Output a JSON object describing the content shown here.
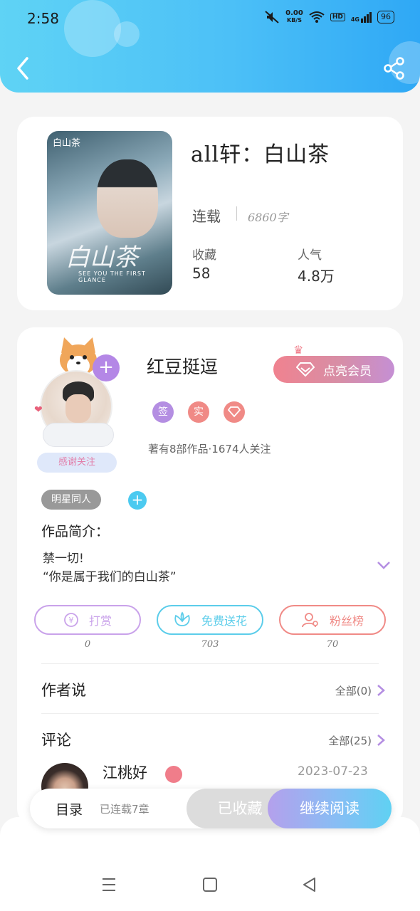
{
  "status_bar": {
    "time": "2:58",
    "net_speed": "0.00",
    "net_unit": "KB/S",
    "hd": "HD",
    "signal": "4G",
    "battery": "96"
  },
  "book": {
    "title": "all轩：白山茶",
    "status": "连载",
    "word_count": "6860字",
    "favorites_label": "收藏",
    "favorites_value": "58",
    "popularity_label": "人气",
    "popularity_value": "4.8万",
    "cover_text": "白山茶",
    "cover_art_title": "白山茶",
    "cover_subtitle": "SEE YOU THE FIRST GLANCE"
  },
  "author": {
    "name": "红豆挺逗",
    "vip_button": "点亮会员",
    "badges": [
      "签",
      "实"
    ],
    "meta": "著有8部作品·1674人关注",
    "thanks_label": "感谢关注",
    "tag": "明星同人",
    "tag_add": "+"
  },
  "intro": {
    "label": "作品简介：",
    "line1": "禁一切!",
    "line2": "“你是属于我们的白山茶”"
  },
  "actions": [
    {
      "label": "打赏",
      "count": "0",
      "color": "#c9a2ea"
    },
    {
      "label": "免费送花",
      "count": "703",
      "color": "#5ccdea"
    },
    {
      "label": "粉丝榜",
      "count": "70",
      "color": "#f08a86"
    }
  ],
  "author_says": {
    "title": "作者说",
    "all": "全部(0)"
  },
  "comments": {
    "title": "评论",
    "all": "全部(25)",
    "first": {
      "name": "江桃好",
      "date": "2023-07-23"
    }
  },
  "bottom_bar": {
    "toc": "目录",
    "toc_sub": "已连载7章",
    "collected": "已收藏",
    "continue": "继续阅读"
  },
  "colors": {
    "header_start": "#5fd3f5",
    "header_end": "#2fa8f5",
    "accent_purple": "#b487e6",
    "vip_pink": "#f0828f"
  },
  "icons": [
    "back-arrow-icon",
    "share-icon",
    "mute-icon",
    "wifi-icon",
    "signal-icon",
    "battery-icon",
    "diamond-icon",
    "flower-icon",
    "fan-icon",
    "yuan-icon",
    "chevron-down-icon",
    "chevron-right-icon",
    "crown-icon",
    "menu-nav-icon",
    "home-nav-icon",
    "back-nav-icon"
  ]
}
